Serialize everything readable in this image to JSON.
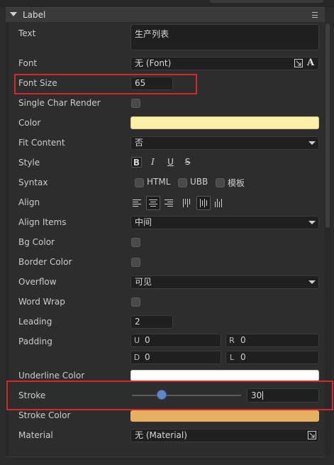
{
  "section": {
    "title": "Label"
  },
  "rows": {
    "text": {
      "label": "Text",
      "value": "生产列表"
    },
    "font": {
      "label": "Font",
      "value": "无 (Font)"
    },
    "font_size": {
      "label": "Font Size",
      "value": "65"
    },
    "single_char_render": {
      "label": "Single Char Render",
      "checked": false
    },
    "color": {
      "label": "Color",
      "value_hex": "#fff0a8"
    },
    "fit_content": {
      "label": "Fit Content",
      "value": "否"
    },
    "style": {
      "label": "Style",
      "bold": "B",
      "italic": "I",
      "underline": "U",
      "strike": "S"
    },
    "syntax": {
      "label": "Syntax",
      "options": [
        "HTML",
        "UBB",
        "模板"
      ]
    },
    "align": {
      "label": "Align"
    },
    "align_items": {
      "label": "Align Items",
      "value": "中间"
    },
    "bg_color": {
      "label": "Bg Color",
      "checked": false
    },
    "border_color": {
      "label": "Border Color",
      "checked": false
    },
    "overflow": {
      "label": "Overflow",
      "value": "可见"
    },
    "word_wrap": {
      "label": "Word Wrap",
      "checked": false
    },
    "leading": {
      "label": "Leading",
      "value": "2"
    },
    "padding": {
      "label": "Padding",
      "u_tag": "U",
      "u_value": "0",
      "r_tag": "R",
      "r_value": "0",
      "d_tag": "D",
      "d_value": "0",
      "l_tag": "L",
      "l_value": "0"
    },
    "underline_color": {
      "label": "Underline Color",
      "value_hex": "#ffffff"
    },
    "stroke": {
      "label": "Stroke",
      "value": "30",
      "slider_fraction": 0.27
    },
    "stroke_color": {
      "label": "Stroke Color",
      "value_hex": "#e8b161"
    },
    "material": {
      "label": "Material",
      "value": "无 (Material)"
    }
  },
  "colors": {
    "highlight_border": "#d8282f",
    "slider_knob": "#5f86c9"
  },
  "icons": {
    "font_pick": "pick-target-icon",
    "font_style": "font-A-icon",
    "material_pick": "pick-target-icon",
    "header_menu": "hamburger-menu-icon",
    "header_collapse": "triangle-down-icon"
  }
}
